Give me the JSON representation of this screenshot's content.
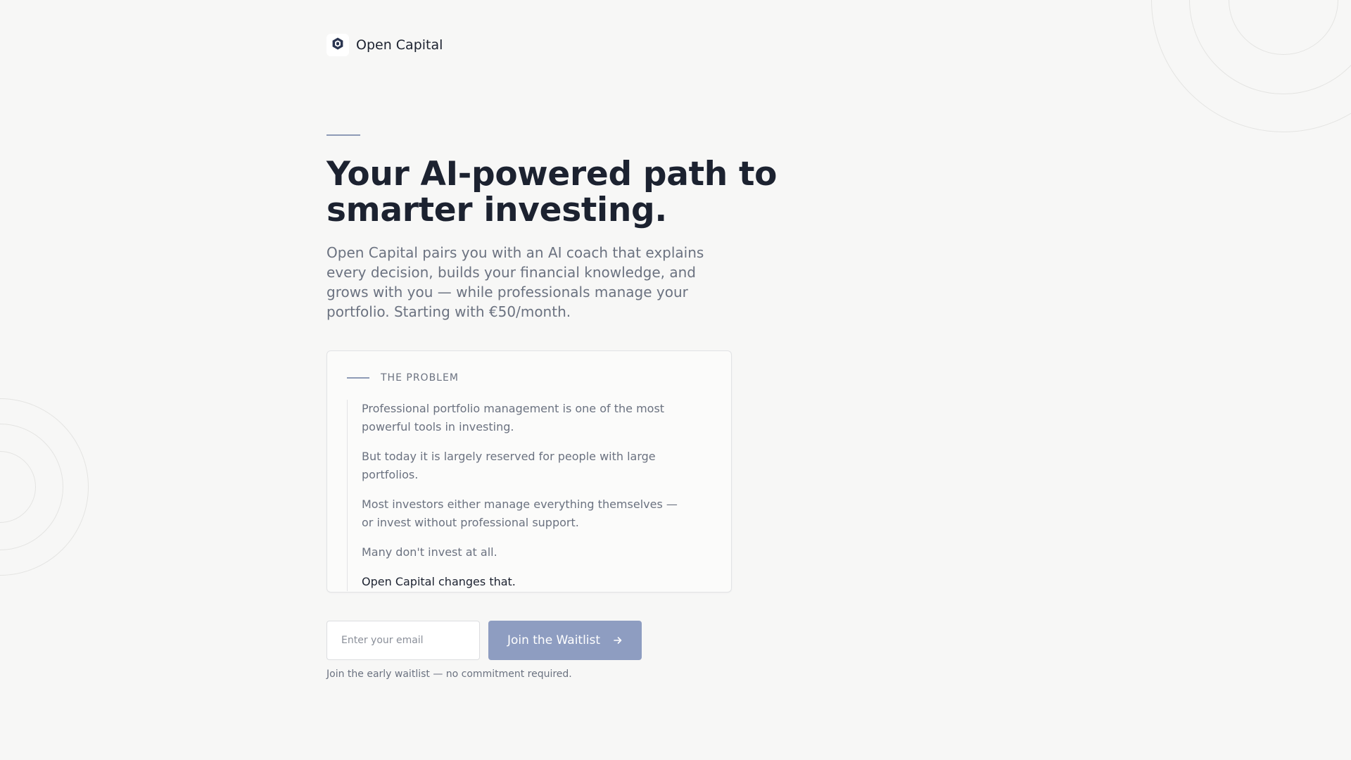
{
  "brand": {
    "name": "Open Capital",
    "logo_icon": "hexagon-ring-icon"
  },
  "hero": {
    "headline": "Your AI-powered path to smarter investing.",
    "subheadline": "Open Capital pairs you with an AI coach that explains every decision, builds your financial knowledge, and grows with you — while professionals manage your portfolio. Starting with €50/month."
  },
  "problem": {
    "label": "THE PROBLEM",
    "paragraphs": [
      "Professional portfolio management is one of the most powerful tools in investing.",
      "But today it is largely reserved for people with large portfolios.",
      "Most investors either manage everything themselves — or invest without professional support.",
      "Many don't invest at all."
    ],
    "closing": "Open Capital changes that."
  },
  "signup": {
    "email_placeholder": "Enter your email",
    "email_value": "",
    "button_label": "Join the Waitlist",
    "button_icon": "arrow-right-icon",
    "note": "Join the early waitlist — no commitment required."
  },
  "colors": {
    "background": "#f7f7f6",
    "text_primary": "#1c2230",
    "text_muted": "#6b7280",
    "accent": "#8e9bb6",
    "button": "#8e9dc1"
  }
}
